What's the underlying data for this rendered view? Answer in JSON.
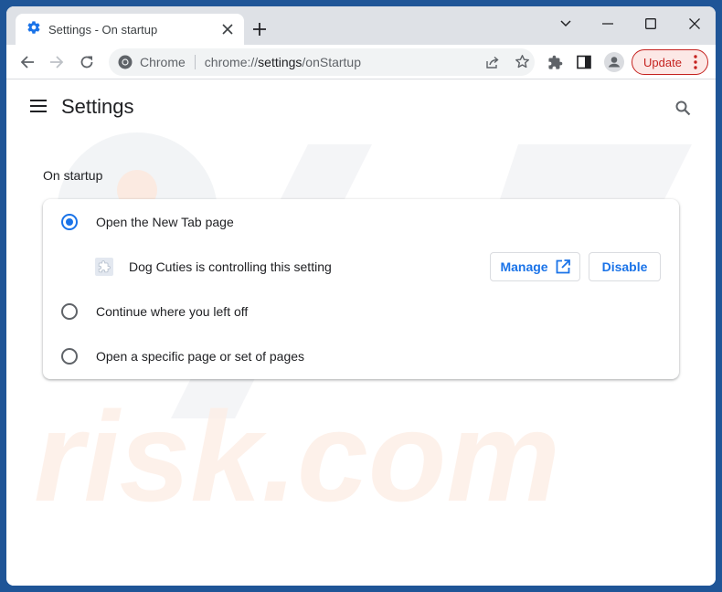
{
  "colors": {
    "accent": "#1a73e8",
    "frame": "#1f5597",
    "titlebar": "#dee1e6",
    "update": "#c5221f"
  },
  "tab": {
    "title": "Settings - On startup",
    "icon": "gear-icon"
  },
  "window_controls": [
    "tab-search",
    "minimize",
    "maximize",
    "close"
  ],
  "omnibox": {
    "site_label": "Chrome",
    "url_prefix": "chrome://",
    "url_host": "settings",
    "url_path": "/onStartup"
  },
  "toolbar": {
    "update_label": "Update"
  },
  "header": {
    "title": "Settings"
  },
  "section": {
    "title": "On startup"
  },
  "startup_options": [
    {
      "label": "Open the New Tab page",
      "checked": true
    },
    {
      "label": "Continue where you left off",
      "checked": false
    },
    {
      "label": "Open a specific page or set of pages",
      "checked": false
    }
  ],
  "extension_notice": {
    "text": "Dog Cuties is controlling this setting",
    "manage_label": "Manage",
    "disable_label": "Disable"
  }
}
